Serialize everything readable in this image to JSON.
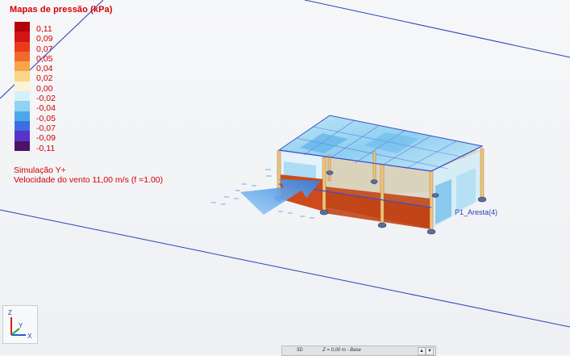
{
  "legend": {
    "title": "Mapas de pressão (kPa)",
    "items": [
      {
        "label": "0,11",
        "color": "#b4000a"
      },
      {
        "label": "0,09",
        "color": "#d41414"
      },
      {
        "label": "0,07",
        "color": "#ea3a1c"
      },
      {
        "label": "0,05",
        "color": "#f26a2a"
      },
      {
        "label": "0,04",
        "color": "#f8a448"
      },
      {
        "label": "0,02",
        "color": "#fbd68a"
      },
      {
        "label": "0,00",
        "color": "#fdf2d6"
      },
      {
        "label": "-0,02",
        "color": "#d6f0fb"
      },
      {
        "label": "-0,04",
        "color": "#8fd2f2"
      },
      {
        "label": "-0,05",
        "color": "#4aa8e8"
      },
      {
        "label": "-0,07",
        "color": "#3b6fe0"
      },
      {
        "label": "-0,09",
        "color": "#5a32c8"
      },
      {
        "label": "-0,11",
        "color": "#4a1468"
      }
    ]
  },
  "simulation": {
    "direction": "Simulação Y+",
    "wind_speed": "Velocidade do vento 11,00 m/s  (f =1.00)"
  },
  "model": {
    "edge_label": "P1_Aresta(4)"
  },
  "axes": {
    "z": "Z",
    "y": "Y",
    "x": "X"
  },
  "status_bar": {
    "view": "3D",
    "level": "Z = 0,00 m - Base",
    "up": "▲",
    "down": "▼"
  }
}
